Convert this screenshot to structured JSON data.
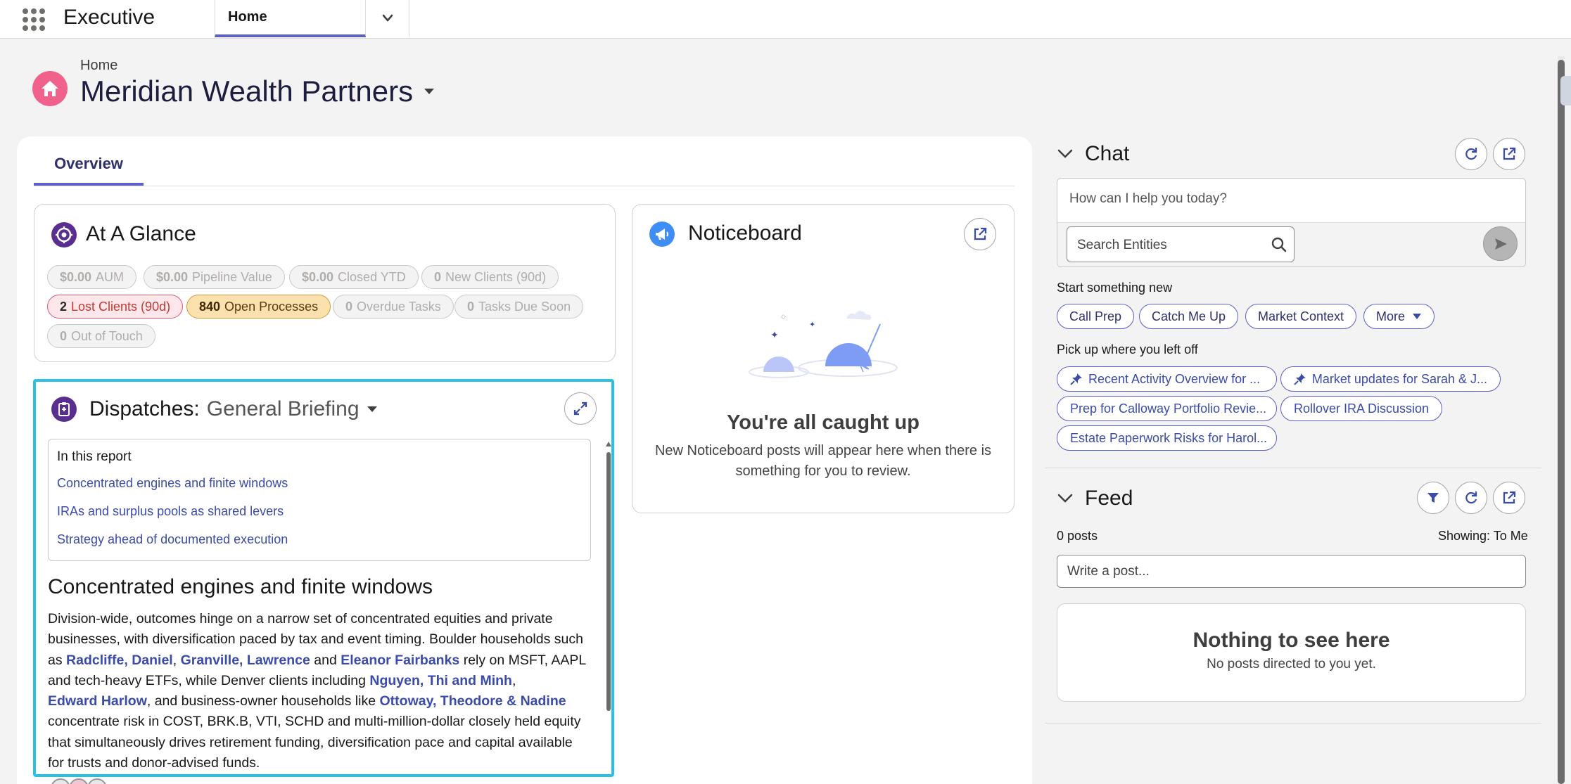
{
  "app": {
    "name": "Executive"
  },
  "nav": {
    "active_tab": "Home"
  },
  "page": {
    "breadcrumb": "Home",
    "title": "Meridian Wealth Partners"
  },
  "tabs": [
    {
      "label": "Overview",
      "active": true
    }
  ],
  "at_a_glance": {
    "title": "At A Glance",
    "pills": [
      {
        "value": "$0.00",
        "label": "AUM",
        "state": "muted"
      },
      {
        "value": "$0.00",
        "label": "Pipeline Value",
        "state": "muted"
      },
      {
        "value": "$0.00",
        "label": "Closed YTD",
        "state": "muted"
      },
      {
        "value": "0",
        "label": "New Clients (90d)",
        "state": "muted"
      },
      {
        "value": "2",
        "label": "Lost Clients (90d)",
        "state": "alert"
      },
      {
        "value": "840",
        "label": "Open Processes",
        "state": "warning"
      },
      {
        "value": "0",
        "label": "Overdue Tasks",
        "state": "muted"
      },
      {
        "value": "0",
        "label": "Tasks Due Soon",
        "state": "muted"
      },
      {
        "value": "0",
        "label": "Out of Touch",
        "state": "muted"
      }
    ]
  },
  "noticeboard": {
    "title": "Noticeboard",
    "empty_title": "You're all caught up",
    "empty_subtitle": "New Noticeboard posts will appear here when there is something for you to review."
  },
  "dispatches": {
    "title": "Dispatches:",
    "selected_report": "General Briefing",
    "toc_title": "In this report",
    "toc": [
      "Concentrated engines and finite windows",
      "IRAs and surplus pools as shared levers",
      "Strategy ahead of documented execution"
    ],
    "section_heading": "Concentrated engines and finite windows",
    "paragraph": [
      {
        "text": "Division-wide, outcomes hinge on a narrow set of concentrated equities and private businesses, with diversification paced by tax and event timing. Boulder households such as "
      },
      {
        "link": "Radcliffe, Daniel"
      },
      {
        "text": ", "
      },
      {
        "link": "Granville, Lawrence"
      },
      {
        "text": " and "
      },
      {
        "link": "Eleanor Fairbanks"
      },
      {
        "text": " rely on MSFT, AAPL and tech-heavy ETFs, while Denver clients including "
      },
      {
        "link": "Nguyen, Thi and Minh"
      },
      {
        "text": ", "
      },
      {
        "link": "Edward Harlow"
      },
      {
        "text": ", and business-owner households like "
      },
      {
        "link": "Ottoway, Theodore & Nadine"
      },
      {
        "text": " concentrate risk in COST, BRK.B, VTI, SCHD and multi-million-dollar closely held equity that simultaneously drives retirement funding, diversification pace and capital available for trusts and donor-advised funds."
      }
    ]
  },
  "chat": {
    "title": "Chat",
    "input_placeholder": "How can I help you today?",
    "search_placeholder": "Search Entities",
    "start_label": "Start something new",
    "quick_actions": [
      "Call Prep",
      "Catch Me Up",
      "Market Context",
      "More"
    ],
    "history_label": "Pick up where you left off",
    "history": [
      {
        "label": "Recent Activity Overview for ...",
        "pinned": true
      },
      {
        "label": "Market updates for Sarah & J...",
        "pinned": true
      },
      {
        "label": "Prep for Calloway Portfolio Revie...",
        "pinned": false
      },
      {
        "label": "Rollover IRA Discussion",
        "pinned": false
      },
      {
        "label": "Estate Paperwork Risks for Harol...",
        "pinned": false
      }
    ]
  },
  "feed": {
    "title": "Feed",
    "post_count": "0 posts",
    "showing": "Showing: To Me",
    "write_placeholder": "Write a post...",
    "empty_title": "Nothing to see here",
    "empty_subtitle": "No posts directed to you yet."
  },
  "colors": {
    "accent": "#5b5fc7",
    "link": "#3b4ba8",
    "highlight": "#2bc0e4",
    "home_badge": "#f0628c",
    "dispatch_icon": "#5a2d91"
  }
}
